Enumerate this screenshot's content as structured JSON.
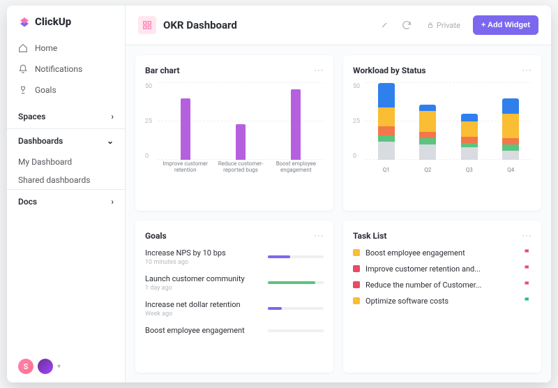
{
  "brand": "ClickUp",
  "sidebar": {
    "nav": [
      {
        "label": "Home",
        "icon": "home-icon"
      },
      {
        "label": "Notifications",
        "icon": "bell-icon"
      },
      {
        "label": "Goals",
        "icon": "trophy-icon"
      }
    ],
    "sections": [
      {
        "name": "Spaces",
        "expanded": false,
        "items": []
      },
      {
        "name": "Dashboards",
        "expanded": true,
        "items": [
          "My Dashboard",
          "Shared dashboards"
        ]
      },
      {
        "name": "Docs",
        "expanded": false,
        "items": []
      }
    ],
    "avatar_initial": "S"
  },
  "header": {
    "title": "OKR Dashboard",
    "private_label": "Private",
    "add_widget_label": "+ Add Widget"
  },
  "cards": {
    "bar_chart": {
      "title": "Bar chart"
    },
    "workload": {
      "title": "Workload by Status"
    },
    "goals": {
      "title": "Goals"
    },
    "tasks": {
      "title": "Task List"
    }
  },
  "goals": [
    {
      "name": "Increase NPS by 10 bps",
      "time": "10 minutes ago",
      "pct": 40,
      "color": "#7b68ee"
    },
    {
      "name": "Launch customer community",
      "time": "1 day ago",
      "pct": 85,
      "color": "#5bc47e"
    },
    {
      "name": "Increase net dollar retention",
      "time": "Week ago",
      "pct": 25,
      "color": "#7b68ee"
    },
    {
      "name": "Boost employee engagement",
      "time": "",
      "pct": 0,
      "color": "#7b68ee"
    }
  ],
  "tasks": [
    {
      "name": "Boost employee engagement",
      "sq": "#f9be33",
      "flag": "#e84b66"
    },
    {
      "name": "Improve customer retention and...",
      "sq": "#e84b66",
      "flag": "#e84b66"
    },
    {
      "name": "Reduce the number of Customer...",
      "sq": "#e84b66",
      "flag": "#e84b66"
    },
    {
      "name": "Optimize software costs",
      "sq": "#f9be33",
      "flag": "#1abc9c"
    }
  ],
  "chart_data": [
    {
      "type": "bar",
      "title": "Bar chart",
      "categories": [
        "Improve customer retention",
        "Reduce customer-reported bugs",
        "Boost employee engagement"
      ],
      "values": [
        40,
        23,
        46
      ],
      "ylim": [
        0,
        50
      ],
      "yticks": [
        0,
        25,
        50
      ],
      "color": "#b660e0"
    },
    {
      "type": "bar",
      "stacked": true,
      "title": "Workload by Status",
      "categories": [
        "Q1",
        "Q2",
        "Q3",
        "Q4"
      ],
      "series": [
        {
          "name": "grey",
          "color": "#d8dbdf",
          "values": [
            12,
            10,
            8,
            6
          ]
        },
        {
          "name": "green",
          "color": "#5bc47e",
          "values": [
            4,
            4,
            3,
            4
          ]
        },
        {
          "name": "orange",
          "color": "#f2784b",
          "values": [
            6,
            4,
            4,
            4
          ]
        },
        {
          "name": "yellow",
          "color": "#f9be33",
          "values": [
            12,
            14,
            10,
            16
          ]
        },
        {
          "name": "blue",
          "color": "#2f80ed",
          "values": [
            16,
            4,
            5,
            10
          ]
        }
      ],
      "ylim": [
        0,
        50
      ],
      "yticks": [
        0,
        25,
        50
      ]
    }
  ]
}
